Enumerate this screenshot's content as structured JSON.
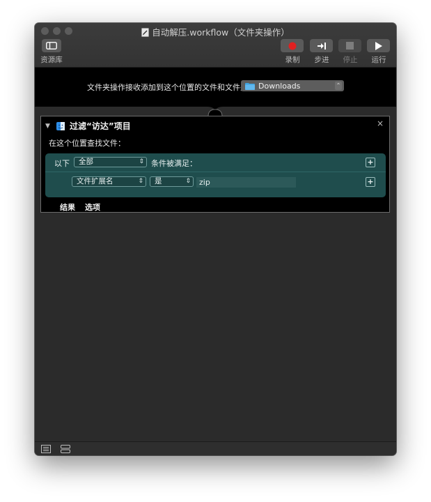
{
  "window": {
    "title": "自动解压.workflow（文件夹操作）"
  },
  "toolbar": {
    "library_label": "资源库",
    "record_label": "录制",
    "step_label": "步进",
    "stop_label": "停止",
    "run_label": "运行",
    "record_color": "#e02020"
  },
  "workflow": {
    "receive_text": "文件夹操作接收添加到这个位置的文件和文件夹",
    "folder": "Downloads"
  },
  "action": {
    "title": "过滤“访达”项目",
    "search_label": "在这个位置查找文件：",
    "criteria": {
      "prefix": "以下",
      "match_mode": "全部",
      "suffix": "条件被满足：",
      "field": "文件扩展名",
      "operator": "是",
      "value": "zip"
    },
    "footer": {
      "results": "结果",
      "options": "选项"
    }
  }
}
